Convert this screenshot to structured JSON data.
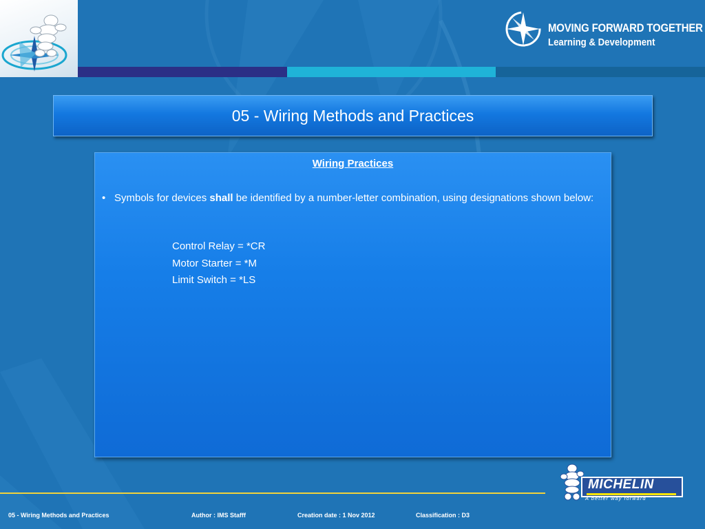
{
  "slide": {
    "title": "05 - Wiring Methods and Practices"
  },
  "brand": {
    "line1": "MOVING FORWARD TOGETHER",
    "line2": "Learning & Development",
    "logo_icon": "compass-star-icon",
    "stripe_colors": [
      "#2b2f86",
      "#1fb3d8",
      "#16649a"
    ]
  },
  "content": {
    "heading": "Wiring Practices",
    "bullet": {
      "before": "Symbols for devices ",
      "emphasis": "shall",
      "after": " be identified by a number-letter combination, using designations shown below:"
    },
    "designations": [
      "Control Relay = *CR",
      "Motor Starter = *M",
      "Limit Switch = *LS"
    ]
  },
  "footer": {
    "course": "05 - Wiring Methods and Practices",
    "author": "Author : IMS Stafff",
    "created": "Creation date : 1 Nov 2012",
    "classification": "Classification : D3",
    "rule_color": "#f2d23a"
  },
  "michelin": {
    "wordmark": "MICHELIN",
    "tagline": "A better way forward",
    "brand_color": "#27509b",
    "accent_color": "#fce500"
  },
  "theme": {
    "background": "#1f74b6",
    "panel": "#167ee8"
  }
}
